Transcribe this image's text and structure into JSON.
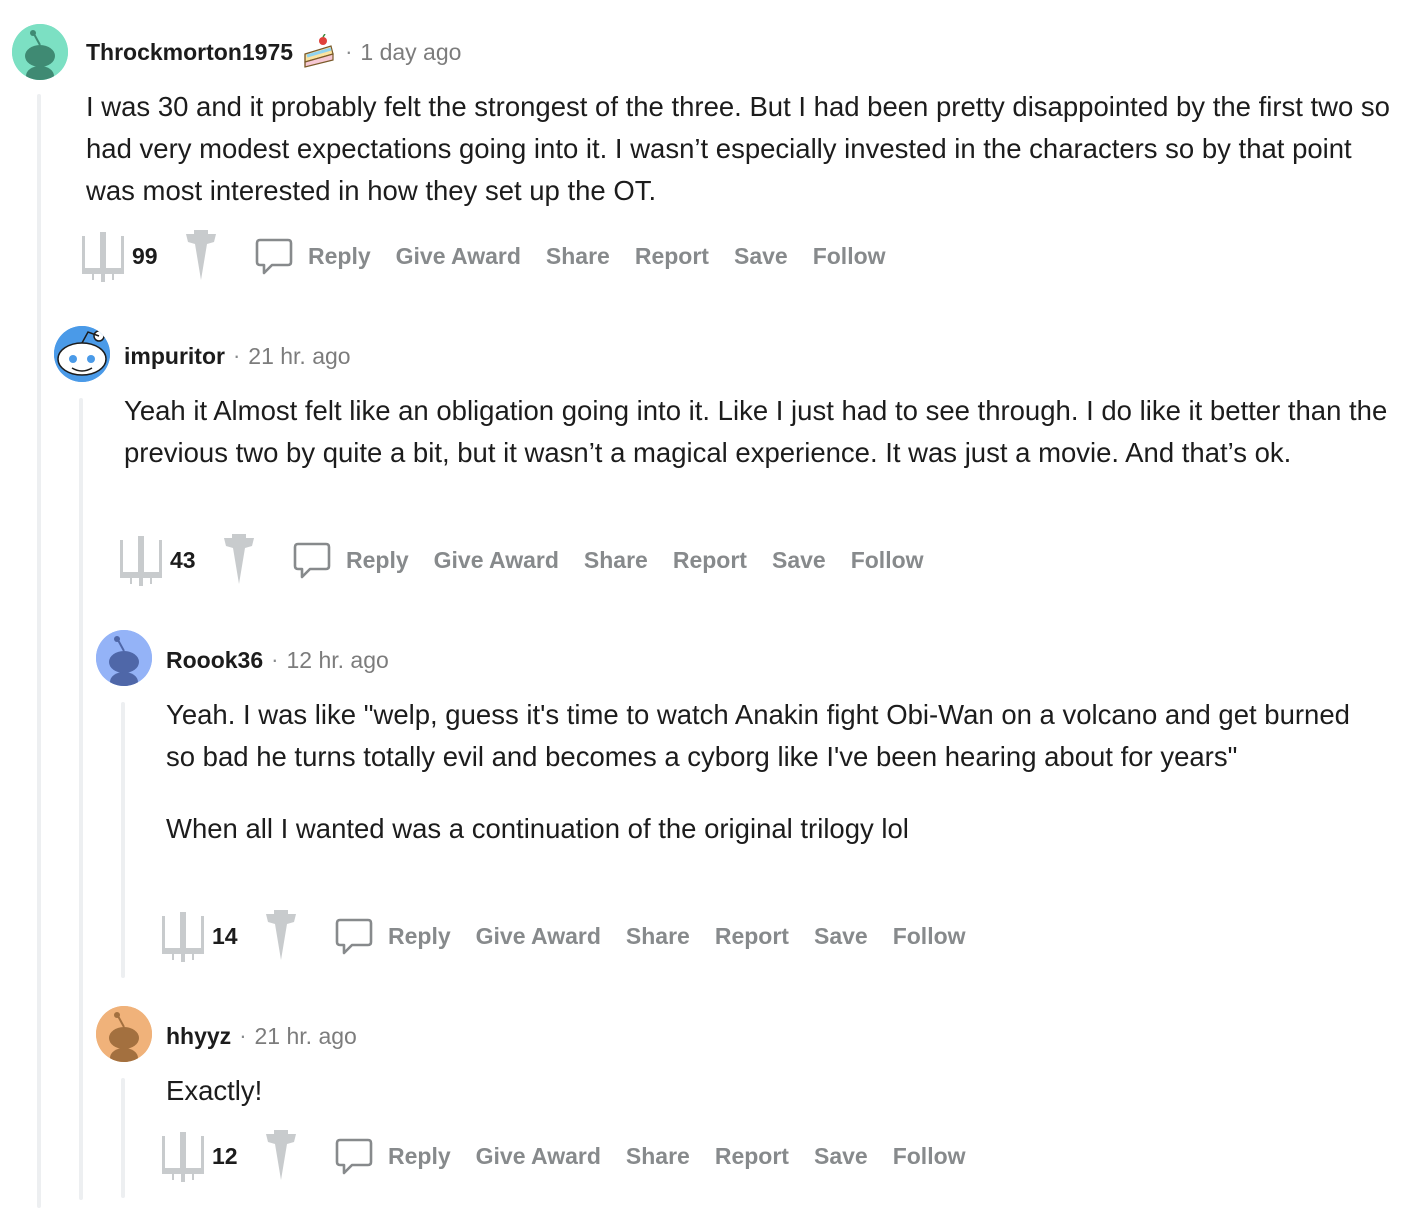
{
  "comments": [
    {
      "username": "Throckmorton1975",
      "flair": "cake-icon",
      "separator": "·",
      "time": "1 day ago",
      "paragraphs": [
        "I was 30 and it probably felt the strongest of the three. But I had been pretty disappointed by the first two so had very modest expectations going into it. I wasn’t especially invested in the characters so by that point was most interested in how they set up the OT."
      ],
      "score": "99",
      "avatar_color": "#7ce0c3"
    },
    {
      "username": "impuritor",
      "separator": "·",
      "time": "21 hr. ago",
      "paragraphs": [
        "Yeah it Almost felt like an obligation going into it. Like I just had to see through. I do like it better than the previous two by quite a bit, but it wasn’t a magical experience. It was just a movie. And that’s ok."
      ],
      "score": "43",
      "avatar_color": "#4a9ae8"
    },
    {
      "username": "Roook36",
      "separator": "·",
      "time": "12 hr. ago",
      "paragraphs": [
        "Yeah. I was like \"welp, guess it's time to watch Anakin fight Obi-Wan on a volcano and get burned so bad he turns totally evil and becomes a cyborg like I've been hearing about for years\"",
        "When all I wanted was a continuation of the original trilogy lol"
      ],
      "score": "14",
      "avatar_color": "#94b3f7"
    },
    {
      "username": "hhyyz",
      "separator": "·",
      "time": "21 hr. ago",
      "paragraphs": [
        "Exactly!"
      ],
      "score": "12",
      "avatar_color": "#f0b27a"
    }
  ],
  "actions": {
    "reply": "Reply",
    "give_award": "Give Award",
    "share": "Share",
    "report": "Report",
    "save": "Save",
    "follow": "Follow"
  },
  "icons": {
    "upvote": "xwing-upvote-icon",
    "downvote": "stardestroyer-downvote-icon",
    "reply": "chat-bubble-icon"
  },
  "colors": {
    "action_text": "#878a8c",
    "icon_gray": "#c8cbcd",
    "thread_line": "#edeff1"
  }
}
